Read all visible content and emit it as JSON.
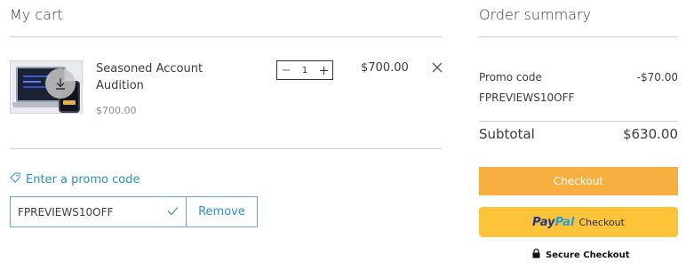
{
  "cart": {
    "title": "My cart",
    "item": {
      "name": "Seasoned Account Audition",
      "unit_price": "$700.00",
      "quantity": "1",
      "total": "$700.00",
      "thumbnail_icon": "download-icon"
    },
    "promo": {
      "link_label": "Enter a promo code",
      "code_value": "FPREVIEWS10OFF",
      "remove_label": "Remove"
    }
  },
  "summary": {
    "title": "Order summary",
    "promo_label": "Promo code",
    "promo_discount": "-$70.00",
    "promo_code": "FPREVIEWS10OFF",
    "subtotal_label": "Subtotal",
    "subtotal_value": "$630.00",
    "checkout_label": "Checkout",
    "paypal_pay": "Pay",
    "paypal_pal": "Pal",
    "paypal_label": "Checkout",
    "secure_label": "Secure Checkout"
  },
  "colors": {
    "accent_link": "#2d8fc4",
    "checkout_button": "#f7b040",
    "paypal_button": "#fdc43a"
  }
}
